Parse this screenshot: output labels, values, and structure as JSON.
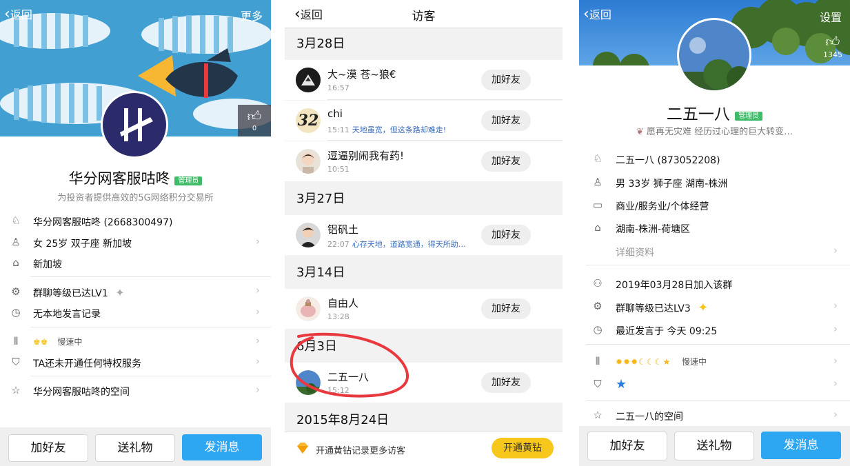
{
  "left": {
    "back_label": "返回",
    "more_label": "更多",
    "like_count": "0",
    "name": "华分网客服咕咚",
    "admin_badge": "管理员",
    "signature": "为投资者提供高效的5G网络积分交易所",
    "rows": [
      {
        "text": "华分网客服咕咚 (2668300497)",
        "icon": "qq-icon"
      },
      {
        "text": "女 25岁 双子座 新加坡",
        "icon": "person-icon"
      },
      {
        "text": "新加坡",
        "icon": "home-icon"
      },
      {
        "text": "群聊等级已达LV1",
        "icon": "gear-icon"
      },
      {
        "text": "无本地发言记录",
        "icon": "clock-icon"
      },
      {
        "text": "慢速中",
        "icon": "chart-icon"
      },
      {
        "text": "TA还未开通任何特权服务",
        "icon": "privilege-icon"
      },
      {
        "text": "华分网客服咕咚的空间",
        "icon": "star-icon"
      }
    ],
    "buttons": {
      "add": "加好友",
      "gift": "送礼物",
      "msg": "发消息"
    }
  },
  "visitors": {
    "back_label": "返回",
    "title": "访客",
    "add_label": "加好友",
    "groups": [
      {
        "date": "3月28日"
      },
      {
        "date": "3月27日"
      },
      {
        "date": "3月14日"
      },
      {
        "date": "6月3日"
      },
      {
        "date": "2015年8月24日"
      }
    ],
    "items": [
      {
        "name": "大~漠 苍~狼€",
        "time": "16:57",
        "sig": ""
      },
      {
        "name": "chi",
        "time": "15:11",
        "sig": "天地虽宽，但这条路却难走!"
      },
      {
        "name": "逗逼别闹我有药!",
        "time": "10:51",
        "sig": ""
      },
      {
        "name": "铝矾土",
        "time": "22:07",
        "sig": "心存天地，道路宽通，得天所助…"
      },
      {
        "name": "自由人",
        "time": "13:28",
        "sig": ""
      },
      {
        "name": "二五一八",
        "time": "15:12",
        "sig": ""
      }
    ],
    "avatar_32_text": "32",
    "footer_text": "开通黄钻记录更多访客",
    "footer_button": "开通黄钻"
  },
  "right": {
    "back_label": "返回",
    "settings_label": "设置",
    "like_count": "1345",
    "name": "二五一八",
    "admin_badge": "管理员",
    "signature": "愿再无灾难 经历过心理的巨大转变…",
    "rows": [
      {
        "text": "二五一八 (873052208)",
        "icon": "qq-icon"
      },
      {
        "text": "男 33岁 狮子座 湖南-株洲",
        "icon": "person-icon"
      },
      {
        "text": "商业/服务业/个体经营",
        "icon": "briefcase-icon"
      },
      {
        "text": "湖南-株洲-荷塘区",
        "icon": "home-icon"
      },
      {
        "text": "详细资料",
        "icon": ""
      },
      {
        "text": "2019年03月28日加入该群",
        "icon": "members-icon"
      },
      {
        "text": "群聊等级已达LV3",
        "icon": "gear-icon"
      },
      {
        "text": "最近发言于 今天 09:25",
        "icon": "clock-icon"
      },
      {
        "text": "慢速中",
        "icon": "chart-icon"
      },
      {
        "text": "",
        "icon": "privilege-icon"
      },
      {
        "text": "二五一八的空间",
        "icon": "star-icon"
      }
    ],
    "buttons": {
      "add": "加好友",
      "gift": "送礼物",
      "msg": "发消息"
    }
  },
  "colors": {
    "accent": "#2ea7f3",
    "admin": "#3dbb67",
    "gold": "#f5c518",
    "annotation": "#e8393f"
  }
}
